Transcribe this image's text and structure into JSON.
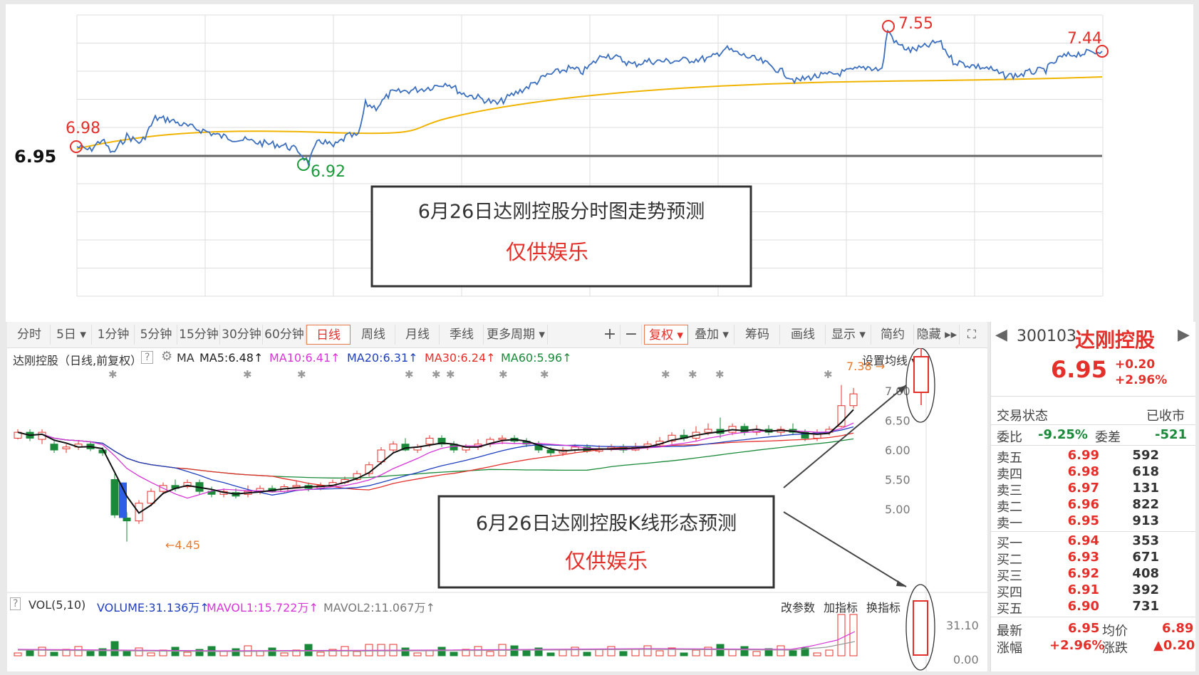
{
  "intraday": {
    "prev_close": "6.95",
    "high_label": "7.55",
    "low_label": "6.92",
    "open_label": "6.98",
    "close_label": "7.44",
    "box_title": "6月26日达刚控股分时图走势预测",
    "box_subtitle": "仅供娱乐"
  },
  "toolbar": {
    "periods": [
      "分时",
      "5日 ▾",
      "1分钟",
      "5分钟",
      "15分钟",
      "30分钟",
      "60分钟",
      "日线",
      "周线",
      "月线",
      "季线",
      "更多周期 ▾"
    ],
    "active_period": "日线",
    "plus": "+",
    "minus": "−",
    "fuquan": "复权 ▾",
    "diejia": "叠加 ▾",
    "chouma": "筹码",
    "huaxian": "画线",
    "xianshi": "显示 ▾",
    "jianyue": "简约",
    "yincang": "隐藏 ▸▸"
  },
  "kline": {
    "title": "达刚控股（日线,前复权）",
    "help": "?",
    "ma_label": "MA",
    "ma5": "MA5:6.48↑",
    "ma10": "MA10:6.41↑",
    "ma20": "MA20:6.31↑",
    "ma30": "MA30:6.24↑",
    "ma60": "MA60:5.96↑",
    "set_ma": "设置均线 ▾",
    "high_label": "7.38 →",
    "low_label": "←4.45",
    "box_title": "6月26日达刚控股K线形态预测",
    "box_subtitle": "仅供娱乐",
    "y_ticks": [
      "7.00",
      "6.50",
      "6.00",
      "5.50",
      "5.00"
    ]
  },
  "volume": {
    "help": "?",
    "vol_label": "VOL(5,10)",
    "volume": "VOLUME:31.136万↑",
    "mavol1": "MAVOL1:15.722万↑",
    "mavol2": "MAVOL2:11.067万↑",
    "gai": "改参数",
    "jia": "加指标",
    "huan": "换指标",
    "y_ticks": [
      "31.10",
      "0.00"
    ]
  },
  "quote": {
    "code": "300103",
    "name": "达刚控股",
    "price": "6.95",
    "change": "+0.20",
    "change_pct": "+2.96%",
    "status_label": "交易状态",
    "status_value": "已收市",
    "weibi_label": "委比",
    "weibi_value": "-9.25%",
    "weicha_label": "委差",
    "weicha_value": "-521",
    "asks": [
      {
        "label": "卖五",
        "price": "6.99",
        "vol": "592"
      },
      {
        "label": "卖四",
        "price": "6.98",
        "vol": "618"
      },
      {
        "label": "卖三",
        "price": "6.97",
        "vol": "131"
      },
      {
        "label": "卖二",
        "price": "6.96",
        "vol": "822"
      },
      {
        "label": "卖一",
        "price": "6.95",
        "vol": "913"
      }
    ],
    "bids": [
      {
        "label": "买一",
        "price": "6.94",
        "vol": "353"
      },
      {
        "label": "买二",
        "price": "6.93",
        "vol": "671"
      },
      {
        "label": "买三",
        "price": "6.92",
        "vol": "408"
      },
      {
        "label": "买四",
        "price": "6.91",
        "vol": "392"
      },
      {
        "label": "买五",
        "price": "6.90",
        "vol": "731"
      }
    ],
    "latest_label": "最新",
    "latest_value": "6.95",
    "avg_label": "均价",
    "avg_value": "6.89",
    "pct_label": "涨幅",
    "pct_value": "+2.96%",
    "chg_label": "涨跌",
    "chg_value": "▲0.20"
  },
  "colors": {
    "up": "#e4302b",
    "down": "#1a8a3a",
    "accent": "#e4302b"
  }
}
